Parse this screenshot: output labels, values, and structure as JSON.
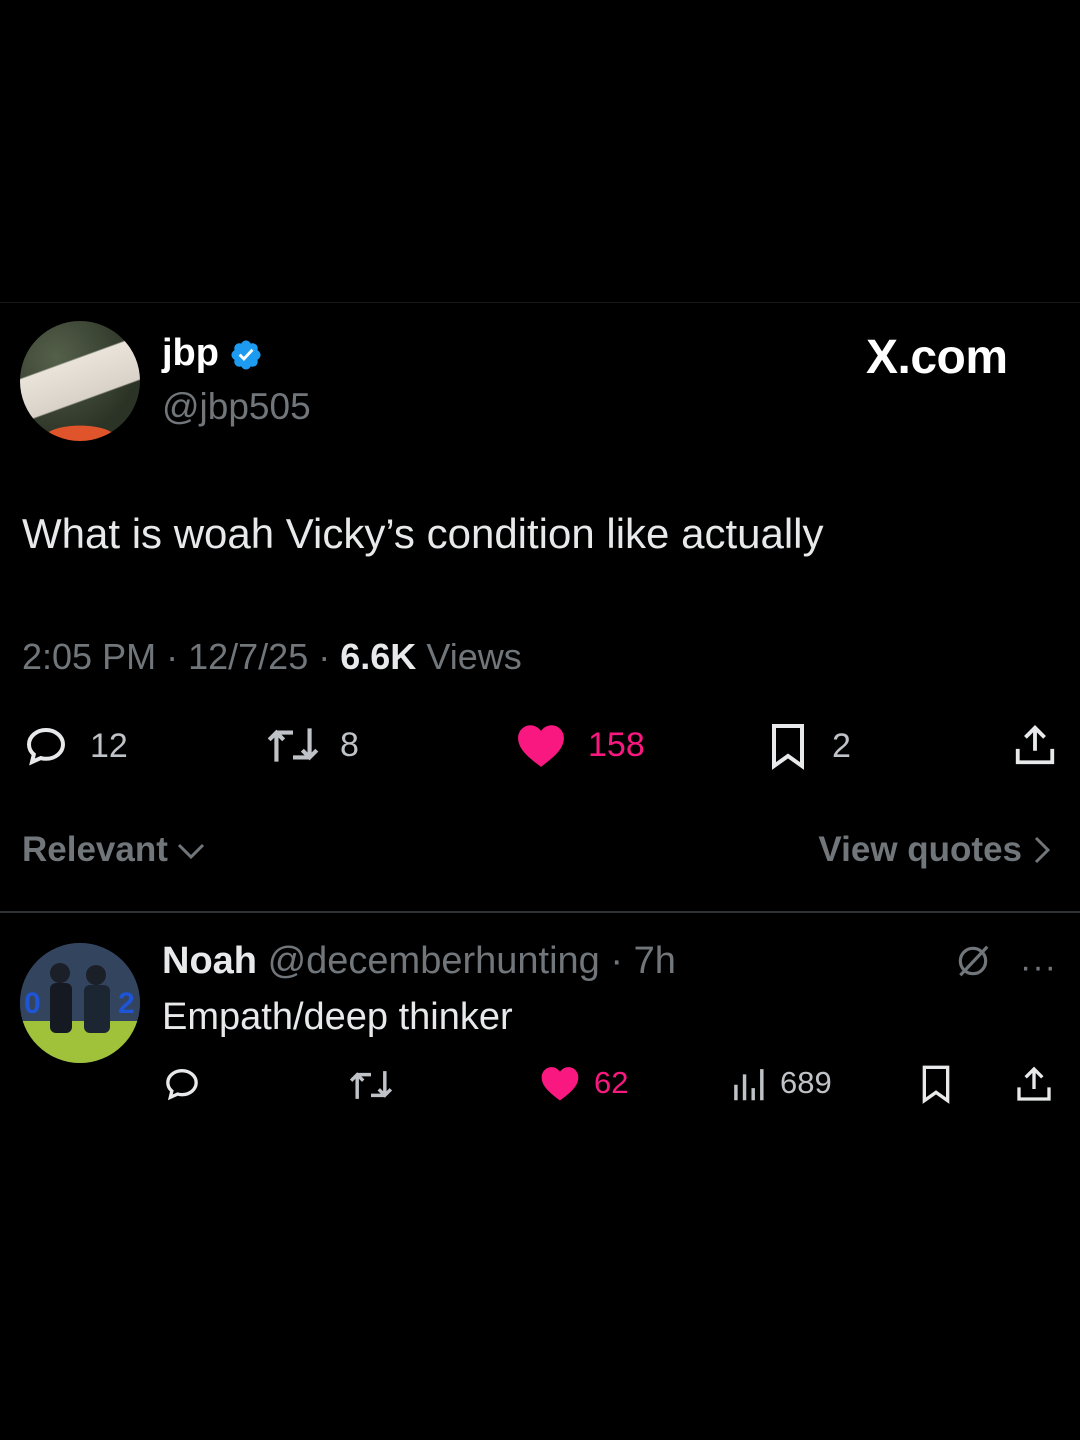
{
  "brand": "X.com",
  "post": {
    "author_name": "jbp",
    "author_handle": "@jbp505",
    "text": "What is woah Vicky’s condition like actually",
    "time": "2:05 PM",
    "date": "12/7/25",
    "views_count": "6.6K",
    "views_label": "Views",
    "separator": "·",
    "replies": "12",
    "reposts": "8",
    "likes": "158",
    "bookmarks": "2"
  },
  "sort": {
    "label": "Relevant"
  },
  "view_quotes": "View quotes",
  "reply": {
    "author_name": "Noah",
    "author_handle": "@decemberhunting",
    "age": "· 7h",
    "text": "Empath/deep thinker",
    "likes": "62",
    "views": "689",
    "more": "···"
  },
  "colors": {
    "background": "#000000",
    "like": "#f91880",
    "muted": "#71767b",
    "verified": "#1d9bf0"
  }
}
